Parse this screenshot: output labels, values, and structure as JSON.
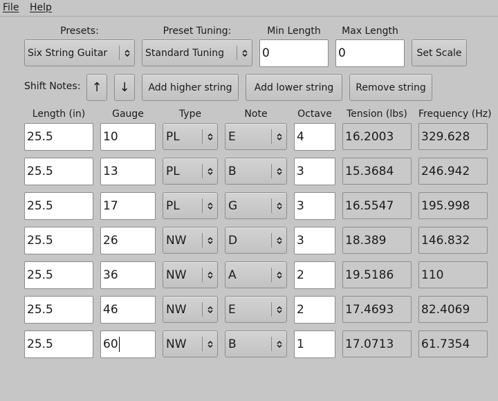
{
  "menu": {
    "file": "File",
    "help": "Help"
  },
  "controls": {
    "presets_label": "Presets:",
    "presets_value": "Six String Guitar",
    "tuning_label": "Preset Tuning:",
    "tuning_value": "Standard Tuning",
    "min_length_label": "Min Length",
    "min_length_value": "0",
    "max_length_label": "Max Length",
    "max_length_value": "0",
    "set_scale_label": "Set Scale",
    "shift_notes_label": "Shift Notes:",
    "shift_up_icon": "arrow-up-icon",
    "shift_down_icon": "arrow-down-icon",
    "shift_up_glyph": "↑",
    "shift_down_glyph": "↓",
    "add_higher_label": "Add higher string",
    "add_lower_label": "Add lower string",
    "remove_label": "Remove string"
  },
  "table": {
    "headers": [
      "Length (in)",
      "Gauge",
      "Type",
      "Note",
      "Octave",
      "Tension (lbs)",
      "Frequency (Hz)"
    ],
    "rows": [
      {
        "length": "25.5",
        "gauge": "10",
        "type": "PL",
        "note": "E",
        "octave": "4",
        "tension": "16.2003",
        "frequency": "329.628"
      },
      {
        "length": "25.5",
        "gauge": "13",
        "type": "PL",
        "note": "B",
        "octave": "3",
        "tension": "15.3684",
        "frequency": "246.942"
      },
      {
        "length": "25.5",
        "gauge": "17",
        "type": "PL",
        "note": "G",
        "octave": "3",
        "tension": "16.5547",
        "frequency": "195.998"
      },
      {
        "length": "25.5",
        "gauge": "26",
        "type": "NW",
        "note": "D",
        "octave": "3",
        "tension": "18.389",
        "frequency": "146.832"
      },
      {
        "length": "25.5",
        "gauge": "36",
        "type": "NW",
        "note": "A",
        "octave": "2",
        "tension": "19.5186",
        "frequency": "110"
      },
      {
        "length": "25.5",
        "gauge": "46",
        "type": "NW",
        "note": "E",
        "octave": "2",
        "tension": "17.4693",
        "frequency": "82.4069"
      },
      {
        "length": "25.5",
        "gauge": "60",
        "type": "NW",
        "note": "B",
        "octave": "1",
        "tension": "17.0713",
        "frequency": "61.7354"
      }
    ]
  }
}
